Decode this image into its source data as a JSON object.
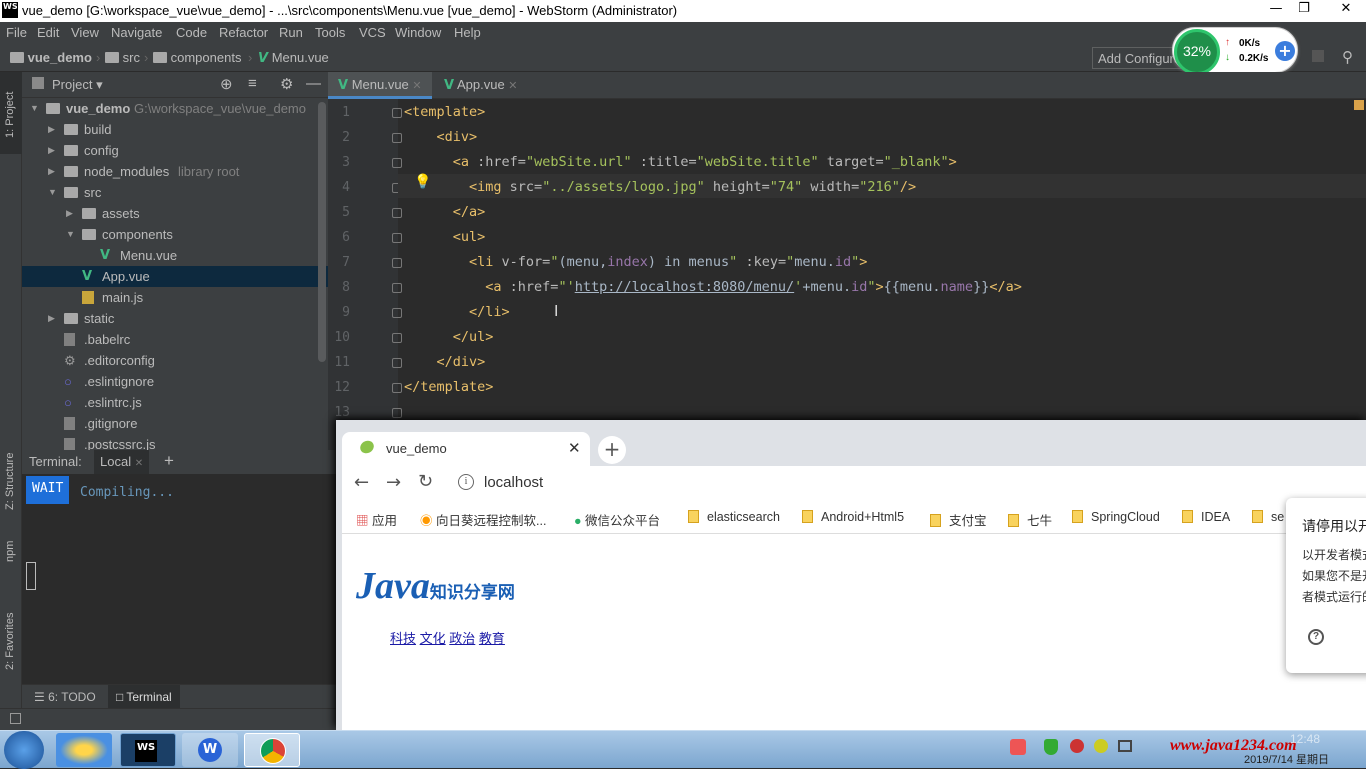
{
  "window": {
    "title": "vue_demo [G:\\workspace_vue\\vue_demo] - ...\\src\\components\\Menu.vue [vue_demo] - WebStorm (Administrator)",
    "icon": "WS"
  },
  "menu": [
    "File",
    "Edit",
    "View",
    "Navigate",
    "Code",
    "Refactor",
    "Run",
    "Tools",
    "VCS",
    "Window",
    "Help"
  ],
  "breadcrumb": [
    "vue_demo",
    "src",
    "components",
    "Menu.vue"
  ],
  "toolbar": {
    "add_config": "Add Configuration..."
  },
  "netmeter": {
    "percent": "32%",
    "up": "0K/s",
    "down": "0.2K/s"
  },
  "side": {
    "project": "1: Project",
    "structure": "Z: Structure",
    "npm": "npm",
    "favorites": "2: Favorites"
  },
  "project": {
    "title": "Project",
    "tree": [
      {
        "label": "vue_demo",
        "extra": "G:\\workspace_vue\\vue_demo",
        "depth": 0,
        "kind": "folder",
        "open": true
      },
      {
        "label": "build",
        "depth": 1,
        "kind": "folder"
      },
      {
        "label": "config",
        "depth": 1,
        "kind": "folder"
      },
      {
        "label": "node_modules",
        "extra": "library root",
        "depth": 1,
        "kind": "folder"
      },
      {
        "label": "src",
        "depth": 1,
        "kind": "folder",
        "open": true
      },
      {
        "label": "assets",
        "depth": 2,
        "kind": "folder"
      },
      {
        "label": "components",
        "depth": 2,
        "kind": "folder",
        "open": true
      },
      {
        "label": "Menu.vue",
        "depth": 3,
        "kind": "vue"
      },
      {
        "label": "App.vue",
        "depth": 2,
        "kind": "vue",
        "selected": true
      },
      {
        "label": "main.js",
        "depth": 2,
        "kind": "js"
      },
      {
        "label": "static",
        "depth": 1,
        "kind": "folder"
      },
      {
        "label": ".babelrc",
        "depth": 1,
        "kind": "file"
      },
      {
        "label": ".editorconfig",
        "depth": 1,
        "kind": "cfg"
      },
      {
        "label": ".eslintignore",
        "depth": 1,
        "kind": "eslint"
      },
      {
        "label": ".eslintrc.js",
        "depth": 1,
        "kind": "eslint"
      },
      {
        "label": ".gitignore",
        "depth": 1,
        "kind": "file"
      },
      {
        "label": ".postcssrc.js",
        "depth": 1,
        "kind": "file"
      }
    ]
  },
  "editor": {
    "tabs": [
      {
        "label": "Menu.vue",
        "active": true
      },
      {
        "label": "App.vue",
        "active": false
      }
    ],
    "lines": [
      "1",
      "2",
      "3",
      "4",
      "5",
      "6",
      "7",
      "8",
      "9",
      "10",
      "11",
      "12",
      "13"
    ]
  },
  "terminal": {
    "label": "Terminal:",
    "tab": "Local",
    "badge": "WAIT",
    "text": "Compiling..."
  },
  "bottom": {
    "todo": "6: TODO",
    "terminal": "Terminal"
  },
  "browser": {
    "tab": "vue_demo",
    "url": "localhost",
    "bookmarks": [
      "应用",
      "向日葵远程控制软...",
      "微信公众平台",
      "elasticsearch",
      "Android+Html5",
      "支付宝",
      "七牛",
      "SpringCloud",
      "IDEA",
      "se"
    ],
    "logo_text": "Java",
    "logo_sub": "知识分享网",
    "links": [
      "科技",
      "文化",
      "政治",
      "教育"
    ],
    "popup": {
      "title": "请停用以开",
      "line1": "以开发者模式",
      "line2": "如果您不是开",
      "line3": "者模式运行的"
    }
  },
  "taskbar": {
    "date": "2019/7/14 星期日",
    "watermark": "www.java1234.com",
    "time": "12:48"
  }
}
